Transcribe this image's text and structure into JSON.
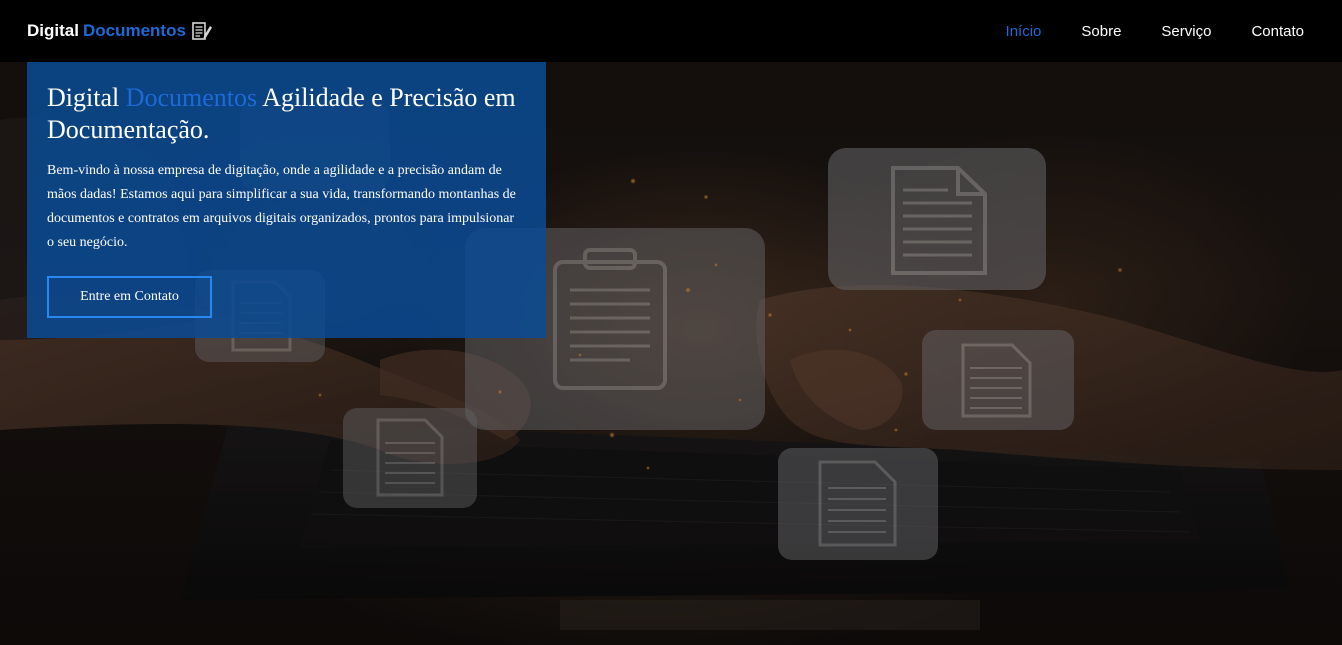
{
  "navbar": {
    "brand": {
      "word1": "Digital",
      "word2": "Documentos",
      "icon": "document-pencil-icon"
    },
    "links": [
      {
        "label": "Início",
        "active": true
      },
      {
        "label": "Sobre",
        "active": false
      },
      {
        "label": "Serviço",
        "active": false
      },
      {
        "label": "Contato",
        "active": false
      }
    ]
  },
  "hero": {
    "title_part1": "Digital",
    "title_accent": "Documentos",
    "title_part2": " Agilidade e Precisão em Documentação.",
    "text": "Bem-vindo à nossa empresa de digitação, onde a agilidade e a precisão andam de mãos dadas! Estamos aqui para simplificar a sua vida, transformando montanhas de documentos e contratos em arquivos digitais organizados, prontos para impulsionar o seu negócio.",
    "button_label": "Entre em Contato",
    "background_image": "hands-typing-laptop-with-floating-document-icons"
  },
  "colors": {
    "navbar_bg": "#000000",
    "accent": "#1d6ad6",
    "hero_card_bg": "#0b4a94",
    "button_border": "#2a86f0",
    "text": "#ffffff"
  }
}
